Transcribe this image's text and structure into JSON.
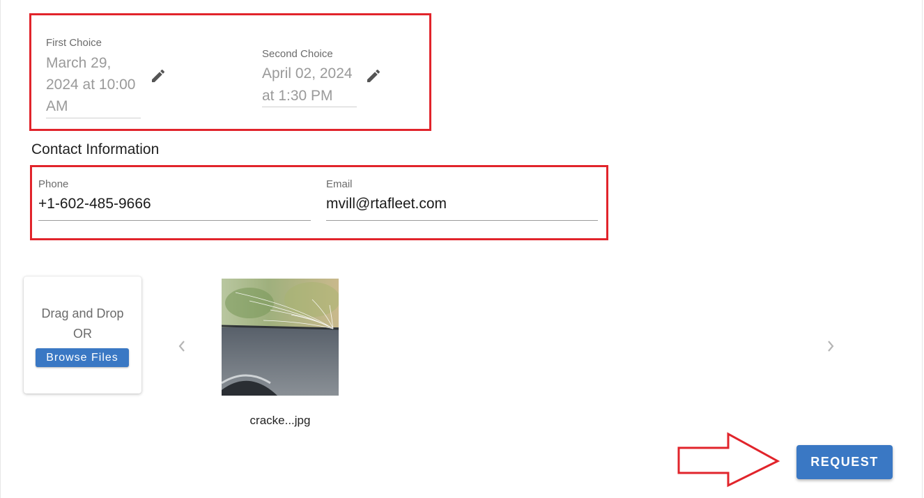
{
  "schedule": {
    "first_choice": {
      "label": "First Choice",
      "value_lines": [
        "March 29,",
        "2024 at 10:00",
        "AM"
      ]
    },
    "second_choice": {
      "label": "Second Choice",
      "value_lines": [
        "April 02, 2024",
        "at 1:30 PM"
      ]
    }
  },
  "contact": {
    "title": "Contact Information",
    "phone": {
      "label": "Phone",
      "value": "+1-602-485-9666"
    },
    "email": {
      "label": "Email",
      "value": "mvill@rtafleet.com"
    }
  },
  "upload": {
    "drag_text": "Drag and Drop",
    "or_text": "OR",
    "browse_label": "Browse Files",
    "files": [
      {
        "name": "cracke...jpg"
      }
    ]
  },
  "actions": {
    "request_label": "REQUEST"
  },
  "colors": {
    "accent": "#3a78c4",
    "highlight": "#e1242b"
  },
  "icons": {
    "edit": "pencil-icon",
    "prev": "chevron-left-icon",
    "next": "chevron-right-icon"
  }
}
